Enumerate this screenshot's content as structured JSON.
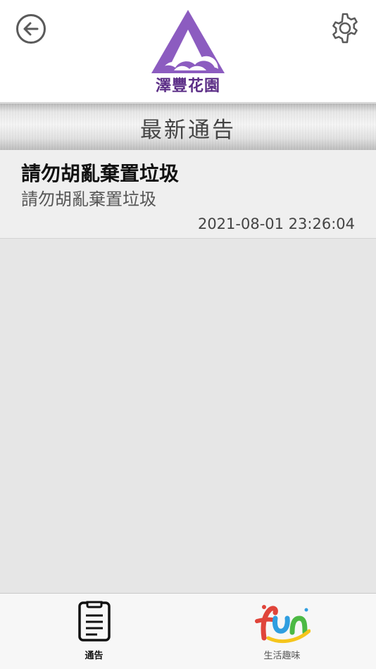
{
  "header": {
    "logo_text": "澤豐花園",
    "back_icon": "back-arrow-icon",
    "settings_icon": "gear-icon",
    "brand_color": "#8c5cc0"
  },
  "section": {
    "title": "最新通告"
  },
  "notices": [
    {
      "title": "請勿胡亂棄置垃圾",
      "body": "請勿胡亂棄置垃圾",
      "datetime": "2021-08-01 23:26:04"
    }
  ],
  "tabbar": {
    "tabs": [
      {
        "label": "通告",
        "icon": "clipboard-icon",
        "active": true
      },
      {
        "label": "生活趣味",
        "icon": "fun-logo-icon",
        "active": false
      }
    ]
  }
}
